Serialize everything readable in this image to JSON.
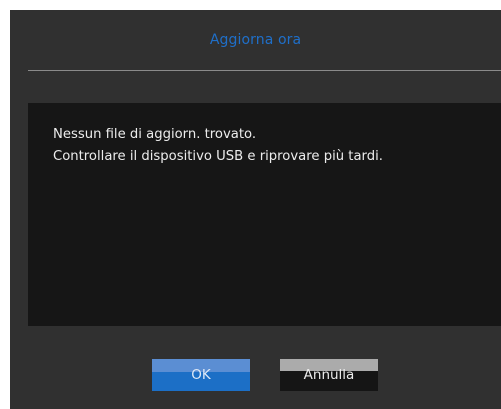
{
  "dialog": {
    "title": "Aggiorna ora",
    "message_line_1": "Nessun file di aggiorn. trovato.",
    "message_line_2": "Controllare il dispositivo USB e riprovare più tardi.",
    "ok_label": "OK",
    "cancel_label": "Annulla"
  },
  "colors": {
    "title_text": "#1f6fc9",
    "dialog_bg": "#303030",
    "panel_bg": "#161616",
    "ok_button": "#1c6fc6",
    "ok_button_highlight": "#5b8ed3",
    "cancel_button_highlight": "#ababab",
    "cancel_button": "#151515"
  }
}
